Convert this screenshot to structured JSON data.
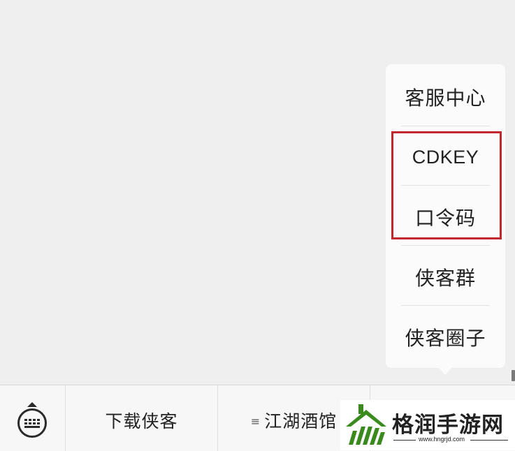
{
  "popup_menu": {
    "items": [
      {
        "label": "客服中心"
      },
      {
        "label": "CDKEY"
      },
      {
        "label": "口令码"
      },
      {
        "label": "侠客群"
      },
      {
        "label": "侠客圈子"
      }
    ]
  },
  "highlight": {
    "color": "#c0282d"
  },
  "bottom_bar": {
    "keyboard_icon": "keyboard-icon",
    "menus": [
      {
        "label": "下载侠客"
      },
      {
        "label": "江湖酒馆",
        "icon": "menu-lines-icon",
        "icon_glyph": "≡"
      },
      {
        "label": ""
      }
    ]
  },
  "watermark": {
    "text": "格润手游网",
    "url": "www.hngrjd.com",
    "logo": "leaf-logo-icon",
    "color": "#3a8a1e"
  }
}
